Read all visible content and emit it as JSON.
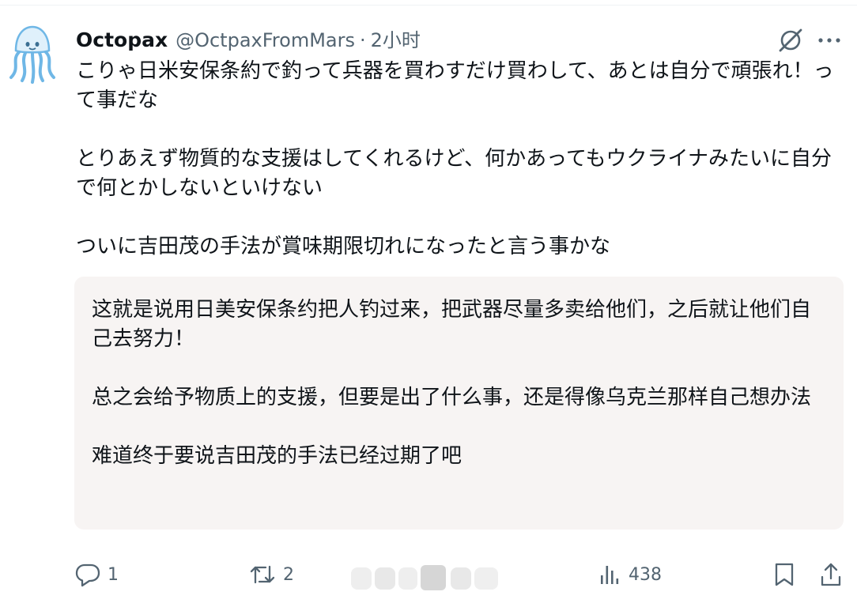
{
  "post": {
    "author": {
      "display_name": "Octopax",
      "handle": "@OctpaxFromMars",
      "separator": "·",
      "time": "2小时"
    },
    "paragraphs": [
      "こりゃ日米安保条約で釣って兵器を買わすだけ買わして、あとは自分で頑張れ！って事だな",
      "とりあえず物質的な支援はしてくれるけど、何かあってもウクライナみたいに自分で何とかしないといけない",
      "ついに吉田茂の手法が賞味期限切れになったと言う事かな"
    ],
    "translation": [
      "这就是说用日美安保条约把人钓过来，把武器尽量多卖给他们，之后就让他们自己去努力！",
      "总之会给予物质上的支援，但要是出了什么事，还是得像乌克兰那样自己想办法",
      "难道终于要说吉田茂的手法已经过期了吧"
    ],
    "actions": {
      "replies": "1",
      "reposts": "2",
      "views": "438"
    }
  },
  "icons": {
    "avatar": "jellyfish-avatar",
    "top_right": [
      "grok-icon",
      "more-icon"
    ],
    "actions": [
      "reply-icon",
      "repost-icon",
      "views-icon",
      "bookmark-icon",
      "share-icon"
    ]
  },
  "colors": {
    "text": "#0f1419",
    "secondary": "#536471",
    "translation_bg": "#f7f4f3",
    "avatar_blue": "#6fb7e6"
  }
}
